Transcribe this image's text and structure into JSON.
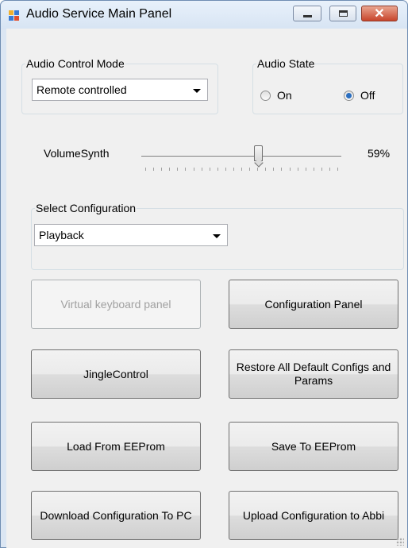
{
  "window": {
    "title": "Audio Service Main Panel"
  },
  "audio_control_mode": {
    "label": "Audio Control Mode",
    "selected": "Remote controlled"
  },
  "audio_state": {
    "label": "Audio State",
    "on_label": "On",
    "off_label": "Off",
    "selected": "Off"
  },
  "volume": {
    "label": "VolumeSynth",
    "value_text": "59%",
    "value": 59,
    "max": 100
  },
  "configuration": {
    "label": "Select Configuration",
    "selected": "Playback"
  },
  "buttons": {
    "virtual_keyboard": "Virtual keyboard panel",
    "configuration_panel": "Configuration Panel",
    "jingle_control": "JingleControl",
    "restore_defaults": "Restore All Default Configs and Params",
    "load_eeprom": "Load From EEProm",
    "save_eeprom": "Save To EEProm",
    "download_config": "Download Configuration To PC",
    "upload_config": "Upload Configuration to Abbi"
  },
  "icons": {
    "app": "app-window-icon",
    "minimize": "minimize-icon",
    "maximize": "maximize-icon",
    "close": "close-icon"
  }
}
